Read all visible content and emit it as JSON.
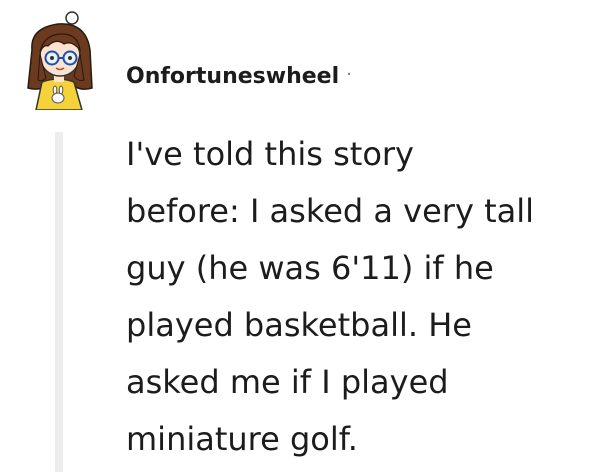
{
  "comment": {
    "username": "Onfortuneswheel",
    "separator": "·",
    "body_lines": [
      "I've told this story",
      "before: I asked a very tall",
      "guy (he was 6'11) if he",
      "played basketball. He",
      "asked me if I played",
      "miniature golf."
    ]
  },
  "avatar": {
    "hair_color": "#6b3a1f",
    "shirt_color": "#f6d23a",
    "skin_color": "#fbe3cf",
    "bow_color": "#ffffff"
  },
  "colors": {
    "text": "#1c1c1c",
    "meta": "#7c7c7c",
    "thread_line": "#ededed"
  }
}
